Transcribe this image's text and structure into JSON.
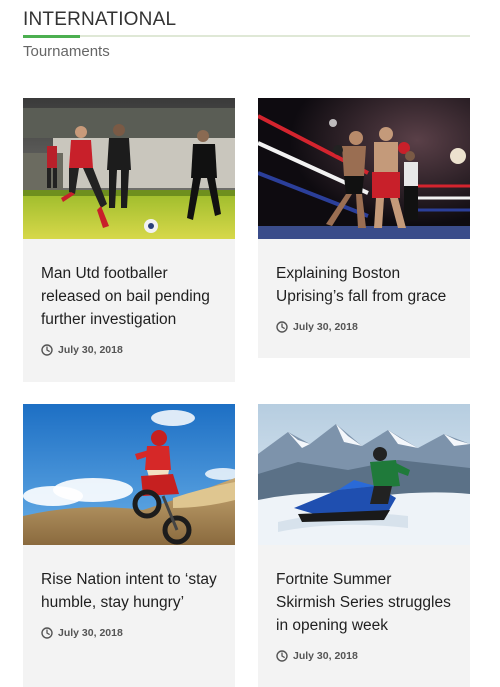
{
  "section": {
    "title": "INTERNATIONAL",
    "subtitle": "Tournaments",
    "accent_color": "#4caf50"
  },
  "articles": [
    {
      "title": "Man Utd footballer released on bail pending further investigation",
      "date": "July 30, 2018",
      "image": "soccer-match-photo"
    },
    {
      "title": "Explaining Boston Uprising’s fall from grace",
      "date": "July 30, 2018",
      "image": "boxing-match-photo"
    },
    {
      "title": "Rise Nation intent to ‘stay humble, stay hungry’",
      "date": "July 30, 2018",
      "image": "motocross-rider-photo"
    },
    {
      "title": "Fortnite Summer Skirmish Series struggles in opening week",
      "date": "July 30, 2018",
      "image": "snowmobile-photo"
    }
  ]
}
